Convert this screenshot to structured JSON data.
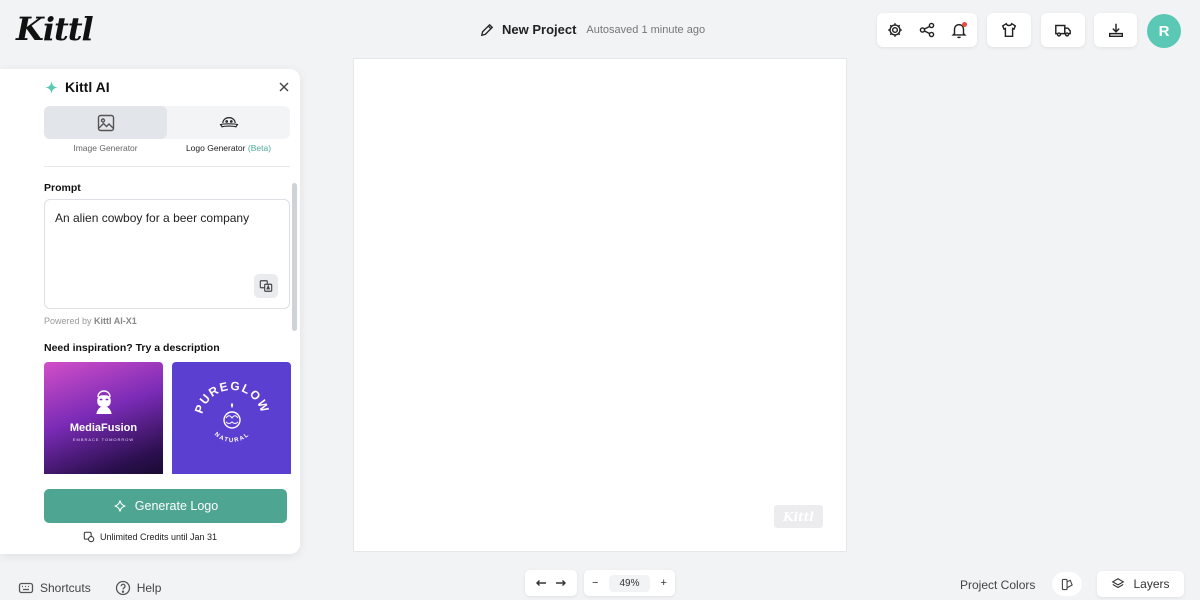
{
  "app": {
    "logo_text": "Kittl"
  },
  "header": {
    "project_title": "New Project",
    "autosave_status": "Autosaved 1 minute ago",
    "avatar_initial": "R",
    "avatar_color": "#5ac8b4",
    "icons": [
      "settings-icon",
      "share-icon",
      "notification-bell-icon",
      "tshirt-icon",
      "delivery-truck-icon",
      "download-icon"
    ]
  },
  "left_toolbar": {
    "tools": [
      "edit-icon",
      "templates-icon",
      "text-icon",
      "shapes-icon",
      "upload-icon",
      "photos-icon",
      "textures-icon",
      "ai-sparkle-icon"
    ]
  },
  "ai_panel": {
    "title": "Kittl AI",
    "tabs": [
      {
        "label": "Image Generator",
        "badge": "",
        "active": true
      },
      {
        "label": "Logo Generator",
        "badge": "(Beta)",
        "active": false
      }
    ],
    "prompt_label": "Prompt",
    "prompt_value": "An alien cowboy for a beer company",
    "powered_by_prefix": "Powered by",
    "powered_by_model": "Kittl AI-X1",
    "inspiration_label": "Need inspiration? Try a description",
    "inspiration_cards": [
      {
        "title": "MediaFusion",
        "subtitle": "EMBRACE TOMORROW"
      },
      {
        "title": "PUREGLOW",
        "subtitle": "NATURAL"
      }
    ],
    "generate_button_label": "Generate Logo",
    "credits_text": "Unlimited Credits until Jan 31",
    "accent_color": "#4ea591"
  },
  "canvas": {
    "watermark_text": "Kittl"
  },
  "footer": {
    "shortcuts_label": "Shortcuts",
    "help_label": "Help",
    "zoom_minus": "−",
    "zoom_level": "49%",
    "zoom_plus": "+",
    "project_colors_label": "Project Colors",
    "layers_label": "Layers"
  }
}
